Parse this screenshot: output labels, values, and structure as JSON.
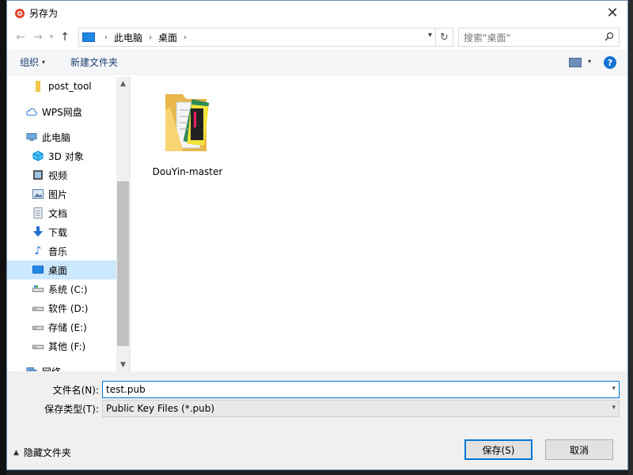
{
  "window": {
    "title": "另存为",
    "close_glyph": "✕"
  },
  "address": {
    "crumbs": [
      "此电脑",
      "桌面"
    ],
    "search_placeholder": "搜索\"桌面\""
  },
  "toolbar": {
    "organize_label": "组织",
    "new_folder_label": "新建文件夹",
    "help_label": "?"
  },
  "sidebar": {
    "items": [
      {
        "label": "post_tool",
        "icon": "folder-icon"
      },
      {
        "label": "WPS网盘",
        "icon": "cloud-icon"
      },
      {
        "label": "此电脑",
        "icon": "computer-icon"
      },
      {
        "label": "3D 对象",
        "icon": "cube-3d-icon"
      },
      {
        "label": "视频",
        "icon": "video-icon"
      },
      {
        "label": "图片",
        "icon": "picture-icon"
      },
      {
        "label": "文档",
        "icon": "document-icon"
      },
      {
        "label": "下载",
        "icon": "download-icon"
      },
      {
        "label": "音乐",
        "icon": "music-icon"
      },
      {
        "label": "桌面",
        "icon": "desktop-icon",
        "selected": true
      },
      {
        "label": "系统 (C:)",
        "icon": "drive-icon"
      },
      {
        "label": "软件 (D:)",
        "icon": "drive-icon"
      },
      {
        "label": "存储 (E:)",
        "icon": "drive-icon"
      },
      {
        "label": "其他 (F:)",
        "icon": "drive-icon"
      },
      {
        "label": "网络",
        "icon": "network-icon"
      }
    ]
  },
  "files": [
    {
      "name": "DouYin-master",
      "icon": "folder-icon"
    }
  ],
  "form": {
    "filename_label": "文件名(N):",
    "filename_value": "test.pub",
    "filetype_label": "保存类型(T):",
    "filetype_value": "Public Key Files (*.pub)"
  },
  "footer": {
    "hide_folders_label": "隐藏文件夹",
    "save_label": "保存(S)",
    "cancel_label": "取消"
  },
  "colors": {
    "accent": "#0078d7",
    "selection": "#cce8ff"
  }
}
